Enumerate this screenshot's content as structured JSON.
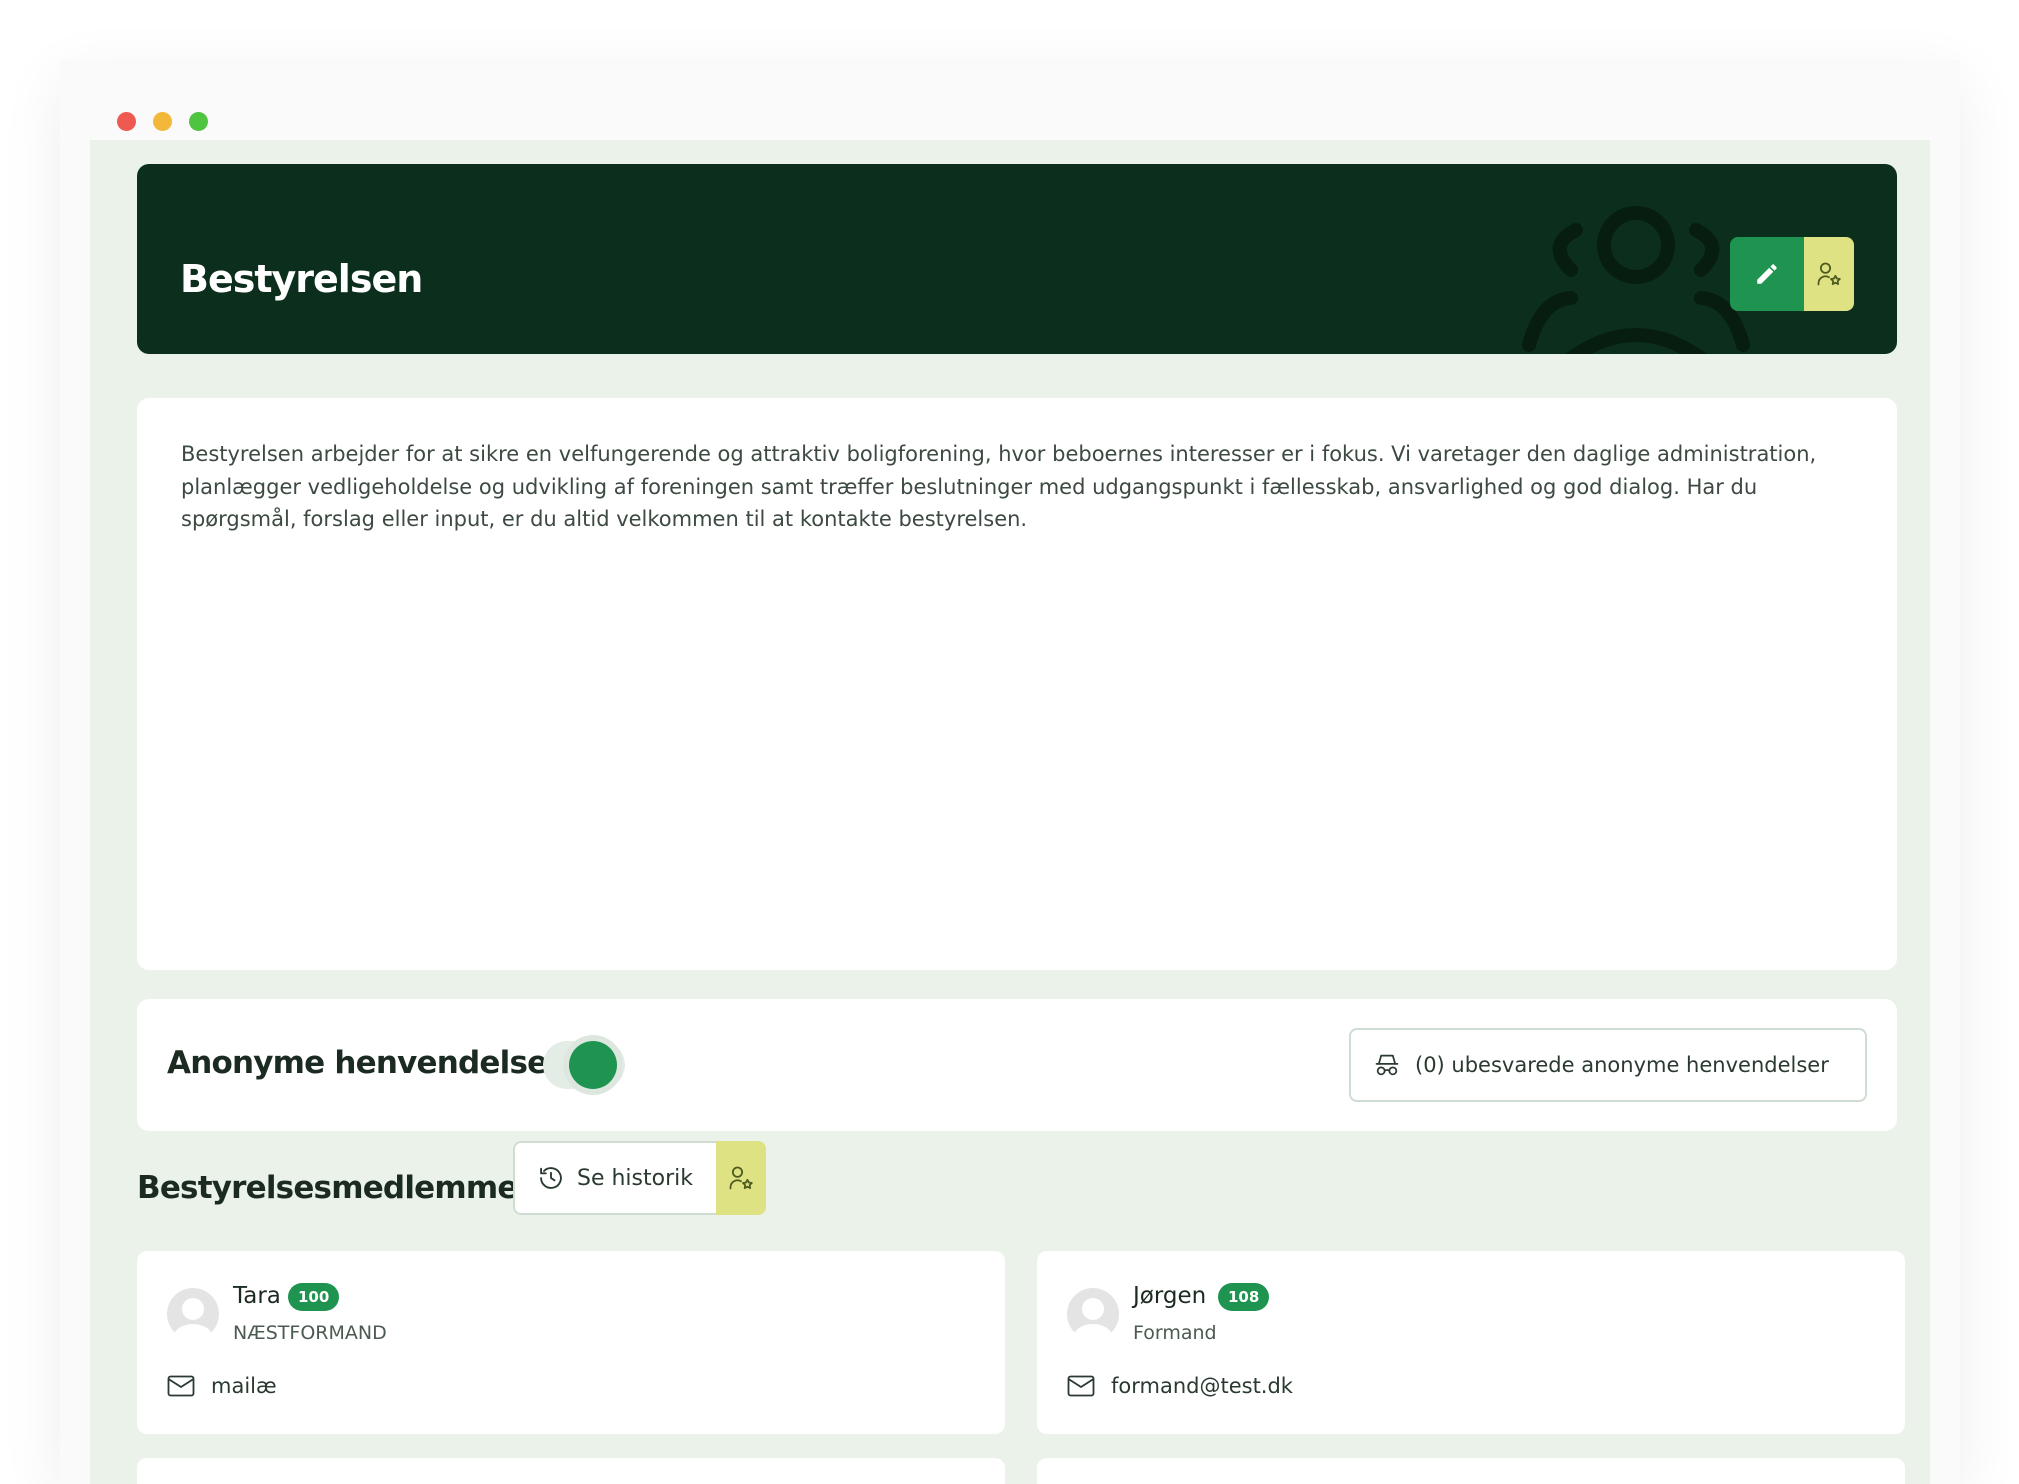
{
  "header": {
    "title": "Bestyrelsen"
  },
  "description": {
    "text": "Bestyrelsen arbejder for at sikre en velfungerende og attraktiv boligforening, hvor beboernes interesser er i fokus. Vi varetager den daglige administration, planlægger vedligeholdelse og udvikling af foreningen samt træffer beslutninger med udgangspunkt i fællesskab, ansvarlighed og god dialog. Har du spørgsmål, forslag eller input, er du altid velkommen til at kontakte bestyrelsen."
  },
  "anonymous": {
    "title": "Anonyme henvendelser",
    "toggle_on": true,
    "unanswered_label": "(0) ubesvarede anonyme henvendelser"
  },
  "members_section": {
    "title": "Bestyrelsesmedlemmer",
    "history_label": "Se historik"
  },
  "members": [
    {
      "name": "Tara",
      "badge": "100",
      "role": "NÆSTFORMAND",
      "email": "mailæ"
    },
    {
      "name": "Jørgen",
      "badge": "108",
      "role": "Formand",
      "email": "formand@test.dk"
    }
  ],
  "colors": {
    "hero_bg": "#0c2e1c",
    "accent_green": "#1f9450",
    "accent_yellow": "#dfe283",
    "page_bg": "#eaf2ea"
  },
  "icons": {
    "hero_bg": "users-group-icon",
    "edit": "pencil-icon",
    "role": "user-star-icon",
    "anonymous": "incognito-icon",
    "history": "history-clock-icon",
    "mail": "mail-icon",
    "avatar": "avatar-placeholder-icon"
  }
}
